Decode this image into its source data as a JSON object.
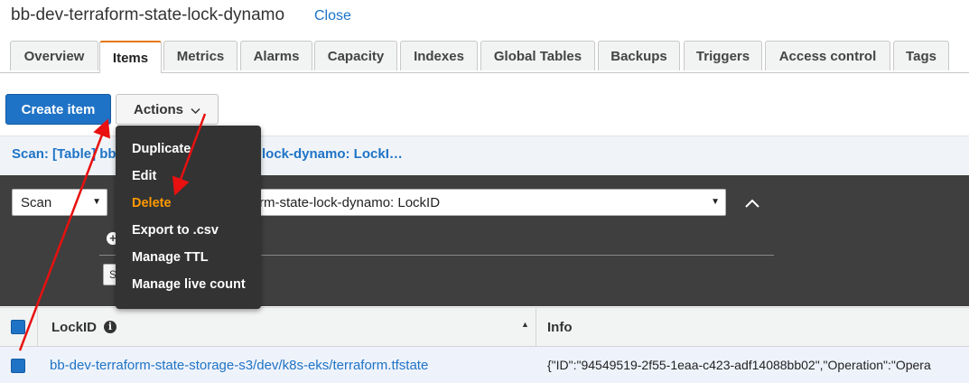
{
  "header": {
    "table_name": "bb-dev-terraform-state-lock-dynamo",
    "close_label": "Close"
  },
  "tabs": [
    {
      "label": "Overview"
    },
    {
      "label": "Items"
    },
    {
      "label": "Metrics"
    },
    {
      "label": "Alarms"
    },
    {
      "label": "Capacity"
    },
    {
      "label": "Indexes"
    },
    {
      "label": "Global Tables"
    },
    {
      "label": "Backups"
    },
    {
      "label": "Triggers"
    },
    {
      "label": "Access control"
    },
    {
      "label": "Tags"
    }
  ],
  "active_tab": "Items",
  "toolbar": {
    "create_label": "Create item",
    "actions_label": "Actions"
  },
  "scan_bar": {
    "prefix_text": "Scan: [Table] bb",
    "suffix_text": "lock-dynamo: LockI…"
  },
  "query_panel": {
    "mode_value": "Scan",
    "table_value": "rm-state-lock-dynamo: LockID",
    "start_label": "S"
  },
  "actions_menu": {
    "items": [
      {
        "label": "Duplicate"
      },
      {
        "label": "Edit"
      },
      {
        "label": "Delete"
      },
      {
        "label": "Export to .csv"
      },
      {
        "label": "Manage TTL"
      },
      {
        "label": "Manage live count"
      }
    ],
    "highlighted": "Delete"
  },
  "table": {
    "columns": [
      {
        "label": "LockID"
      },
      {
        "label": "Info"
      }
    ],
    "rows": [
      {
        "lockid": "bb-dev-terraform-state-storage-s3/dev/k8s-eks/terraform.tfstate",
        "info": "{\"ID\":\"94549519-2f55-1eaa-c423-adf14088bb02\",\"Operation\":\"Opera"
      }
    ]
  },
  "colors": {
    "primary": "#1f73c6",
    "accent_tab": "#e47911",
    "highlight": "#ff9900",
    "annotation": "#e81010"
  },
  "icons": {
    "chevron": "chevron-down-icon",
    "collapse": "caret-up-icon",
    "info": "info-icon",
    "sort": "sort-asc-icon",
    "add": "plus-circle-icon"
  }
}
